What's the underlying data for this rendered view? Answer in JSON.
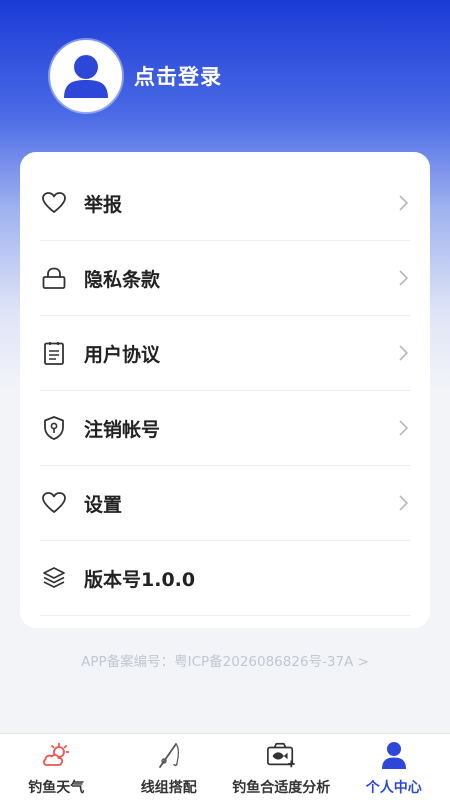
{
  "colors": {
    "accent": "#2d48d8",
    "header_top": "#1b3bd6",
    "text": "#222222",
    "muted": "#c2c6d2",
    "weather_icon": "#f0534e"
  },
  "profile": {
    "login_label": "点击登录",
    "avatar_icon": "user-avatar-icon"
  },
  "menu": {
    "items": [
      {
        "label": "举报",
        "icon": "heart-icon"
      },
      {
        "label": "隐私条款",
        "icon": "lock-icon"
      },
      {
        "label": "用户协议",
        "icon": "clipboard-icon"
      },
      {
        "label": "注销帐号",
        "icon": "shield-icon"
      },
      {
        "label": "设置",
        "icon": "heart-icon"
      },
      {
        "label": "版本号1.0.0",
        "icon": "layers-icon"
      }
    ]
  },
  "record": {
    "text": "APP备案编号：粤ICP备2026086826号-37A >"
  },
  "tabbar": {
    "tabs": [
      {
        "label": "钓鱼天气",
        "icon": "weather-icon",
        "active": false
      },
      {
        "label": "线组搭配",
        "icon": "fishing-rod-icon",
        "active": false
      },
      {
        "label": "钓鱼合适度分析",
        "icon": "fish-analysis-icon",
        "active": false
      },
      {
        "label": "个人中心",
        "icon": "person-icon",
        "active": true
      }
    ]
  }
}
